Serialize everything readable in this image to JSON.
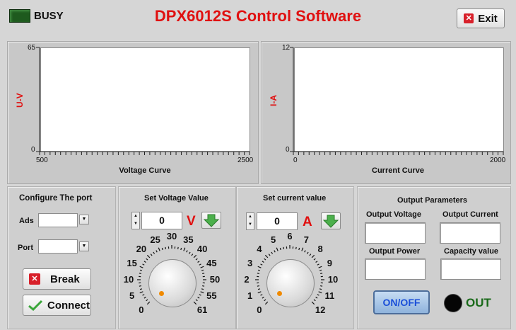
{
  "header": {
    "busy_label": "BUSY",
    "title": "DPX6012S  Control Software",
    "exit_label": "Exit"
  },
  "chart_data": [
    {
      "type": "line",
      "ylabel": "U-V",
      "xlabel": "Voltage Curve",
      "xlim": [
        500,
        2500
      ],
      "ylim": [
        0,
        65
      ],
      "x_ticks": [
        "500",
        "2500"
      ],
      "y_ticks": [
        "65",
        "0"
      ],
      "series": []
    },
    {
      "type": "line",
      "ylabel": "I-A",
      "xlabel": "Current Curve",
      "xlim": [
        0,
        2000
      ],
      "ylim": [
        0,
        12
      ],
      "x_ticks": [
        "0",
        "2000"
      ],
      "y_ticks": [
        "12",
        "0"
      ],
      "series": []
    }
  ],
  "port": {
    "title": "Configure  The port",
    "ads_label": "Ads",
    "ads_value": "",
    "port_label": "Port",
    "port_value": "",
    "break_label": "Break",
    "connect_label": "Connect"
  },
  "voltage": {
    "title": "Set Voltage Value",
    "value": "0",
    "unit": "V",
    "dial_labels": [
      "0",
      "5",
      "10",
      "15",
      "20",
      "25",
      "30",
      "35",
      "40",
      "45",
      "50",
      "55",
      "61"
    ],
    "dial_value": 0
  },
  "current": {
    "title": "Set current value",
    "value": "0",
    "unit": "A",
    "dial_labels": [
      "0",
      "1",
      "2",
      "3",
      "4",
      "5",
      "6",
      "7",
      "8",
      "9",
      "10",
      "11",
      "12"
    ],
    "dial_value": 0
  },
  "output": {
    "title": "Output Parameters",
    "voltage_label": "Output Voltage",
    "current_label": "Output Current",
    "power_label": "Output Power",
    "capacity_label": "Capacity value",
    "voltage_value": "",
    "current_value": "",
    "power_value": "",
    "capacity_value": "",
    "onoff_label": "ON/OFF",
    "out_label": "OUT"
  },
  "colors": {
    "title": "#e01010",
    "unit": "#e01010",
    "onoff_text": "#1a4fd8",
    "out_text": "#1a6a1a",
    "knob_dot": "#f08a00"
  },
  "icons": {
    "exit": "close-icon",
    "break": "close-icon",
    "connect": "check-icon",
    "apply": "down-arrow-icon"
  }
}
